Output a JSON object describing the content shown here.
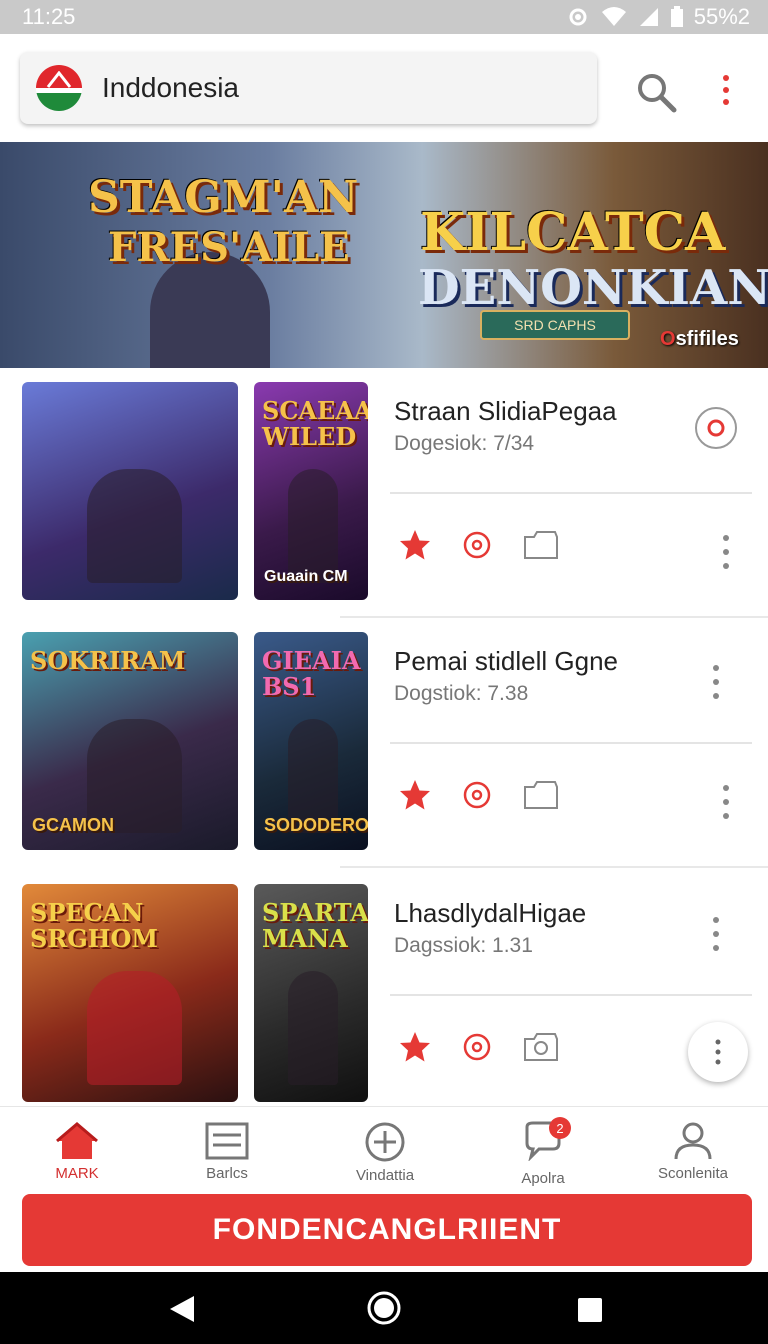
{
  "status_bar": {
    "time": "11:25",
    "battery": "55%2"
  },
  "header": {
    "country": "Inddonesia",
    "icons": {
      "search": "search-icon",
      "menu": "more-vertical-icon"
    }
  },
  "banner": {
    "title_left_line1": "STAGM'AN",
    "title_left_line2": "FRES'AILE",
    "title_right_line1": "KILCATCA",
    "title_right_line2": "DENONKIAN",
    "plaque": "SRD CAPHS",
    "brand": "sfifiles",
    "brand_mark": "O"
  },
  "games": [
    {
      "title": "Straan SlidiaPegaa",
      "subtitle": "Dogesiok: 7/34",
      "thumb_a": {
        "top_text": "",
        "bottom_text": ""
      },
      "thumb_b": {
        "top_text": "SCAEAAR WILED",
        "bottom_text": "Guaain CM"
      },
      "right_icon": "record-icon"
    },
    {
      "title": "Pemai stidlell Ggne",
      "subtitle": "Dogstiok: 7.38",
      "thumb_a": {
        "top_text": "SOKRIRAM",
        "bottom_text": "GCAMON"
      },
      "thumb_b": {
        "top_text": "GIEAIA BS1",
        "bottom_text": "SODODERO"
      },
      "right_icon": "more-vertical-icon"
    },
    {
      "title": "LhasdlydalHigae",
      "subtitle": "Dagssiok: 1.31",
      "thumb_a": {
        "top_text": "SPECAN SRGHOM",
        "bottom_text": ""
      },
      "thumb_b": {
        "top_text": "SPARTA MANA",
        "bottom_text": ""
      },
      "right_icon": "more-vertical-icon"
    }
  ],
  "bottom_nav": [
    {
      "label": "MARK",
      "icon": "home-icon",
      "active": true
    },
    {
      "label": "Barlcs",
      "icon": "list-icon",
      "active": false
    },
    {
      "label": "Vindattia",
      "icon": "add-circle-icon",
      "active": false
    },
    {
      "label": "Apolra",
      "icon": "chat-icon",
      "active": false,
      "badge": "2"
    },
    {
      "label": "Sconlenita",
      "icon": "profile-icon",
      "active": false
    }
  ],
  "cta": {
    "label": "FONDENCANGLRIIENT"
  },
  "colors": {
    "accent": "#e53935",
    "status_bar": "#c9c9c9",
    "system_nav": "#000000"
  }
}
